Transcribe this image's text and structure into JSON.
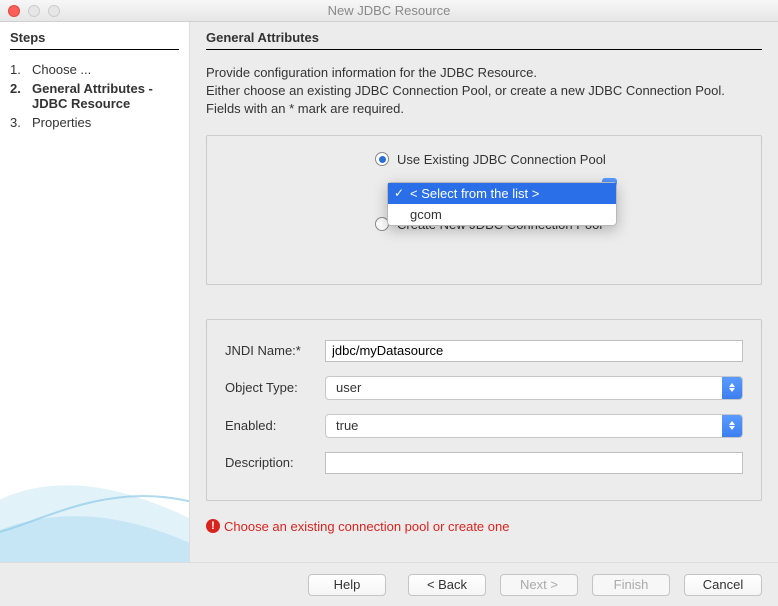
{
  "window": {
    "title": "New JDBC Resource"
  },
  "sidebar": {
    "heading": "Steps",
    "items": [
      {
        "num": "1.",
        "label": "Choose ..."
      },
      {
        "num": "2.",
        "label": "General Attributes - JDBC Resource"
      },
      {
        "num": "3.",
        "label": "Properties"
      }
    ]
  },
  "content": {
    "heading": "General Attributes",
    "intro_line1": "Provide configuration information for the JDBC Resource.",
    "intro_line2": "Either choose an existing JDBC Connection Pool, or create a new JDBC Connection Pool.",
    "intro_line3": "Fields with an * mark are required."
  },
  "pool_panel": {
    "radio_existing": "Use Existing JDBC Connection Pool",
    "radio_create": "Create New JDBC Connection Pool",
    "dropdown": {
      "placeholder": "< Select from the list >",
      "options": [
        "gcom"
      ]
    }
  },
  "fields": {
    "jndi_label": "JNDI Name:*",
    "jndi_value": "jdbc/myDatasource",
    "object_type_label": "Object Type:",
    "object_type_value": "user",
    "enabled_label": "Enabled:",
    "enabled_value": "true",
    "description_label": "Description:",
    "description_value": ""
  },
  "error": {
    "message": "Choose an existing connection pool or create one"
  },
  "buttons": {
    "help": "Help",
    "back": "< Back",
    "next": "Next >",
    "finish": "Finish",
    "cancel": "Cancel"
  }
}
